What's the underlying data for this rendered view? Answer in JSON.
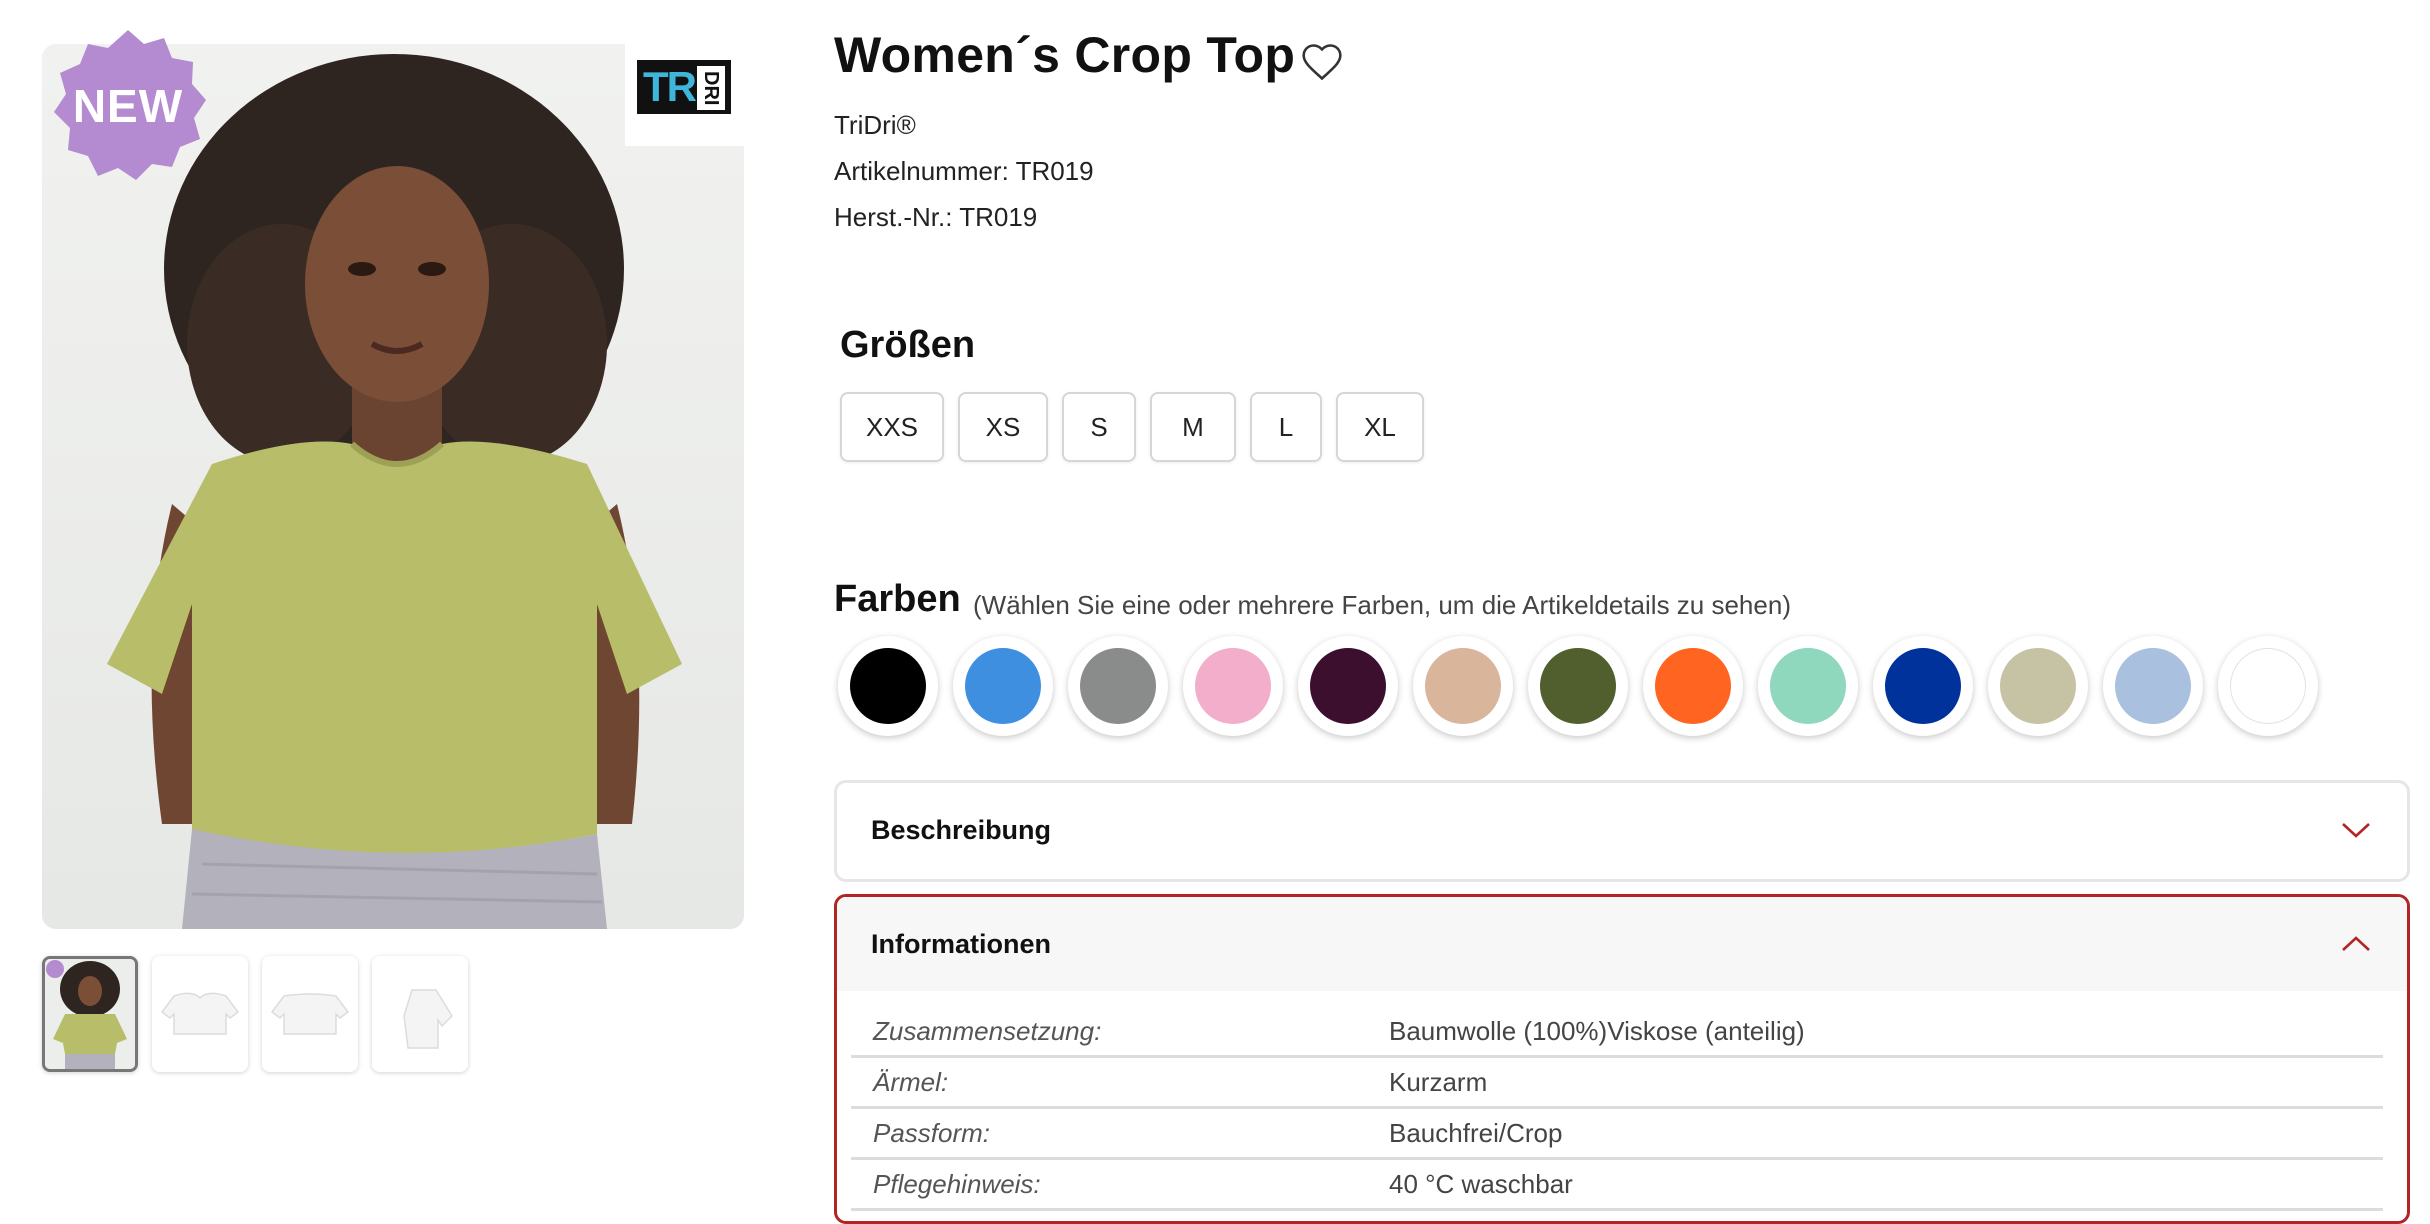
{
  "product": {
    "title": "Women´s Crop Top",
    "brand": "TriDri®",
    "article_number": "Artikelnummer: TR019",
    "manufacturer_number": "Herst.-Nr.: TR019"
  },
  "gallery": {
    "badge": "NEW",
    "logo_text_left": "TRI",
    "logo_text_right": "DRI",
    "thumbnail_count": 4,
    "active_thumbnail": 1
  },
  "sizes": {
    "heading": "Größen",
    "options": [
      "XXS",
      "XS",
      "S",
      "M",
      "L",
      "XL"
    ]
  },
  "colors": {
    "heading": "Farben",
    "hint": "(Wählen Sie eine oder mehrere Farben, um die Artikeldetails zu sehen)",
    "swatches": [
      "#000000",
      "#3f8fe0",
      "#8a8c8c",
      "#f2aecb",
      "#3c0f2f",
      "#d9b59c",
      "#505f2d",
      "#ff6520",
      "#8fd8bd",
      "#00329b",
      "#c6c2a4",
      "#a9c0de",
      "#ffffff"
    ]
  },
  "accordion": {
    "description_label": "Beschreibung",
    "information_label": "Informationen",
    "rows": [
      {
        "key": "Zusammensetzung:",
        "value": "Baumwolle (100%)Viskose (anteilig)"
      },
      {
        "key": "Ärmel:",
        "value": "Kurzarm"
      },
      {
        "key": "Passform:",
        "value": "Bauchfrei/Crop"
      },
      {
        "key": "Pflegehinweis:",
        "value": "40 °C waschbar"
      }
    ]
  },
  "theme": {
    "accent": "#b32424",
    "badge_color": "#b48ad0",
    "logo_cyan": "#3fb6d9"
  }
}
